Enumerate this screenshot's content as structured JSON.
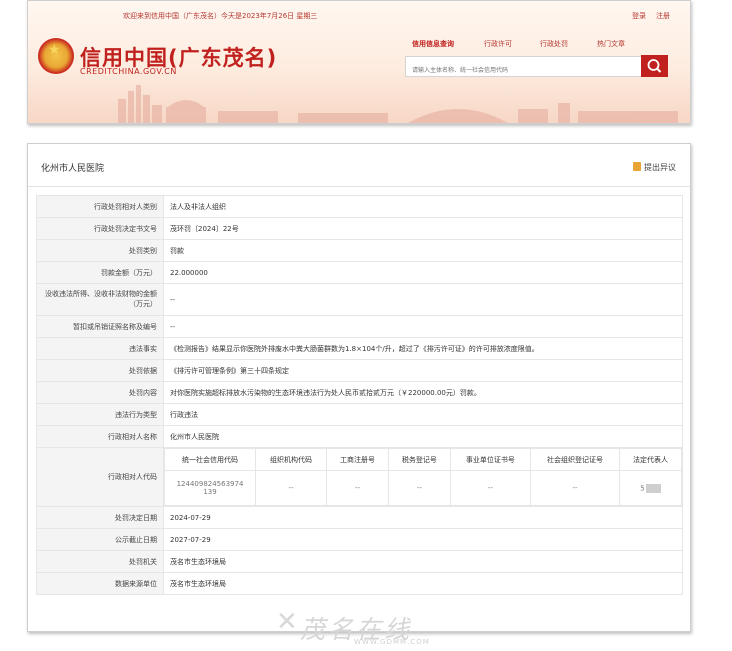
{
  "header": {
    "welcome": "欢迎来到信用中国（广东茂名）今天是2023年7月26日 星期三",
    "login": "登录",
    "register": "注册",
    "logo_title": "信用中国(广东茂名)",
    "logo_sub": "CREDITCHINA.GOV.CN",
    "nav": [
      {
        "label": "信用信息查询"
      },
      {
        "label": "行政许可"
      },
      {
        "label": "行政处罚"
      },
      {
        "label": "热门文章"
      }
    ],
    "search_placeholder": "请输入主体名称、统一社会信用代码",
    "colors": {
      "brand": "#c1211e"
    }
  },
  "panel": {
    "title": "化州市人民医院",
    "objection": "提出异议",
    "rows": [
      {
        "label": "行政处罚相对人类别",
        "value": "法人及非法人组织"
      },
      {
        "label": "行政处罚决定书文号",
        "value": "茂环罚〔2024〕22号"
      },
      {
        "label": "处罚类别",
        "value": "罚款"
      },
      {
        "label": "罚款金额（万元）",
        "value": "22.000000"
      },
      {
        "label": "没收违法所得、没收非法财物的金额（万元）",
        "value": "--"
      },
      {
        "label": "暂扣或吊销证照名称及编号",
        "value": "--"
      },
      {
        "label": "违法事实",
        "value": "《检测报告》结果显示你医院外排废水中粪大肠菌群数为1.8×104个/升，超过了《排污许可证》的许可排放浓度限值。"
      },
      {
        "label": "处罚依据",
        "value": "《排污许可管理条例》第三十四条规定"
      },
      {
        "label": "处罚内容",
        "value": "对你医院实施超标排放水污染物的生态环境违法行为处人民币贰拾贰万元（￥220000.00元）罚款。"
      },
      {
        "label": "违法行为类型",
        "value": "行政违法"
      },
      {
        "label": "行政相对人名称",
        "value": "化州市人民医院"
      }
    ],
    "code_row": {
      "label": "行政相对人代码",
      "headers": [
        "统一社会信用代码",
        "组织机构代码",
        "工商注册号",
        "税务登记号",
        "事业单位证书号",
        "社会组织登记证号",
        "法定代表人"
      ],
      "values": [
        "124409824563974139",
        "--",
        "--",
        "--",
        "--",
        "--",
        "5"
      ]
    },
    "rows_after": [
      {
        "label": "处罚决定日期",
        "value": "2024-07-29"
      },
      {
        "label": "公示截止日期",
        "value": "2027-07-29"
      },
      {
        "label": "处罚机关",
        "value": "茂名市生态环境局"
      },
      {
        "label": "数据来源单位",
        "value": "茂名市生态环境局"
      }
    ]
  },
  "watermark": {
    "text": "茂名在线",
    "url": "WWW.GDMM.COM"
  }
}
